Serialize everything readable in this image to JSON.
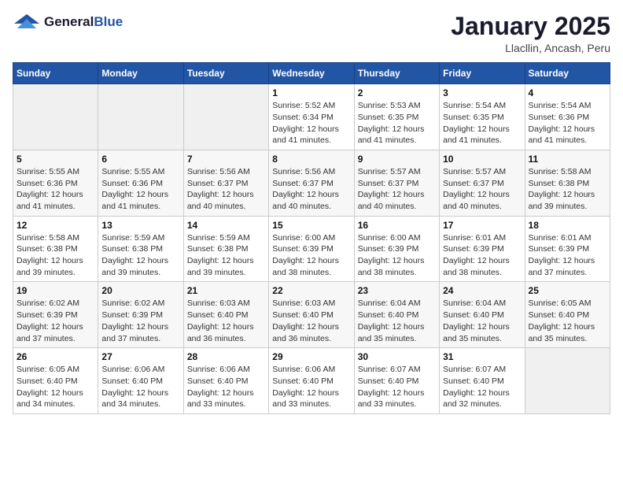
{
  "header": {
    "logo_general": "General",
    "logo_blue": "Blue",
    "month_title": "January 2025",
    "location": "Llacllin, Ancash, Peru"
  },
  "days_of_week": [
    "Sunday",
    "Monday",
    "Tuesday",
    "Wednesday",
    "Thursday",
    "Friday",
    "Saturday"
  ],
  "weeks": [
    [
      {
        "num": "",
        "detail": ""
      },
      {
        "num": "",
        "detail": ""
      },
      {
        "num": "",
        "detail": ""
      },
      {
        "num": "1",
        "detail": "Sunrise: 5:52 AM\nSunset: 6:34 PM\nDaylight: 12 hours\nand 41 minutes."
      },
      {
        "num": "2",
        "detail": "Sunrise: 5:53 AM\nSunset: 6:35 PM\nDaylight: 12 hours\nand 41 minutes."
      },
      {
        "num": "3",
        "detail": "Sunrise: 5:54 AM\nSunset: 6:35 PM\nDaylight: 12 hours\nand 41 minutes."
      },
      {
        "num": "4",
        "detail": "Sunrise: 5:54 AM\nSunset: 6:36 PM\nDaylight: 12 hours\nand 41 minutes."
      }
    ],
    [
      {
        "num": "5",
        "detail": "Sunrise: 5:55 AM\nSunset: 6:36 PM\nDaylight: 12 hours\nand 41 minutes."
      },
      {
        "num": "6",
        "detail": "Sunrise: 5:55 AM\nSunset: 6:36 PM\nDaylight: 12 hours\nand 41 minutes."
      },
      {
        "num": "7",
        "detail": "Sunrise: 5:56 AM\nSunset: 6:37 PM\nDaylight: 12 hours\nand 40 minutes."
      },
      {
        "num": "8",
        "detail": "Sunrise: 5:56 AM\nSunset: 6:37 PM\nDaylight: 12 hours\nand 40 minutes."
      },
      {
        "num": "9",
        "detail": "Sunrise: 5:57 AM\nSunset: 6:37 PM\nDaylight: 12 hours\nand 40 minutes."
      },
      {
        "num": "10",
        "detail": "Sunrise: 5:57 AM\nSunset: 6:37 PM\nDaylight: 12 hours\nand 40 minutes."
      },
      {
        "num": "11",
        "detail": "Sunrise: 5:58 AM\nSunset: 6:38 PM\nDaylight: 12 hours\nand 39 minutes."
      }
    ],
    [
      {
        "num": "12",
        "detail": "Sunrise: 5:58 AM\nSunset: 6:38 PM\nDaylight: 12 hours\nand 39 minutes."
      },
      {
        "num": "13",
        "detail": "Sunrise: 5:59 AM\nSunset: 6:38 PM\nDaylight: 12 hours\nand 39 minutes."
      },
      {
        "num": "14",
        "detail": "Sunrise: 5:59 AM\nSunset: 6:38 PM\nDaylight: 12 hours\nand 39 minutes."
      },
      {
        "num": "15",
        "detail": "Sunrise: 6:00 AM\nSunset: 6:39 PM\nDaylight: 12 hours\nand 38 minutes."
      },
      {
        "num": "16",
        "detail": "Sunrise: 6:00 AM\nSunset: 6:39 PM\nDaylight: 12 hours\nand 38 minutes."
      },
      {
        "num": "17",
        "detail": "Sunrise: 6:01 AM\nSunset: 6:39 PM\nDaylight: 12 hours\nand 38 minutes."
      },
      {
        "num": "18",
        "detail": "Sunrise: 6:01 AM\nSunset: 6:39 PM\nDaylight: 12 hours\nand 37 minutes."
      }
    ],
    [
      {
        "num": "19",
        "detail": "Sunrise: 6:02 AM\nSunset: 6:39 PM\nDaylight: 12 hours\nand 37 minutes."
      },
      {
        "num": "20",
        "detail": "Sunrise: 6:02 AM\nSunset: 6:39 PM\nDaylight: 12 hours\nand 37 minutes."
      },
      {
        "num": "21",
        "detail": "Sunrise: 6:03 AM\nSunset: 6:40 PM\nDaylight: 12 hours\nand 36 minutes."
      },
      {
        "num": "22",
        "detail": "Sunrise: 6:03 AM\nSunset: 6:40 PM\nDaylight: 12 hours\nand 36 minutes."
      },
      {
        "num": "23",
        "detail": "Sunrise: 6:04 AM\nSunset: 6:40 PM\nDaylight: 12 hours\nand 35 minutes."
      },
      {
        "num": "24",
        "detail": "Sunrise: 6:04 AM\nSunset: 6:40 PM\nDaylight: 12 hours\nand 35 minutes."
      },
      {
        "num": "25",
        "detail": "Sunrise: 6:05 AM\nSunset: 6:40 PM\nDaylight: 12 hours\nand 35 minutes."
      }
    ],
    [
      {
        "num": "26",
        "detail": "Sunrise: 6:05 AM\nSunset: 6:40 PM\nDaylight: 12 hours\nand 34 minutes."
      },
      {
        "num": "27",
        "detail": "Sunrise: 6:06 AM\nSunset: 6:40 PM\nDaylight: 12 hours\nand 34 minutes."
      },
      {
        "num": "28",
        "detail": "Sunrise: 6:06 AM\nSunset: 6:40 PM\nDaylight: 12 hours\nand 33 minutes."
      },
      {
        "num": "29",
        "detail": "Sunrise: 6:06 AM\nSunset: 6:40 PM\nDaylight: 12 hours\nand 33 minutes."
      },
      {
        "num": "30",
        "detail": "Sunrise: 6:07 AM\nSunset: 6:40 PM\nDaylight: 12 hours\nand 33 minutes."
      },
      {
        "num": "31",
        "detail": "Sunrise: 6:07 AM\nSunset: 6:40 PM\nDaylight: 12 hours\nand 32 minutes."
      },
      {
        "num": "",
        "detail": ""
      }
    ]
  ]
}
